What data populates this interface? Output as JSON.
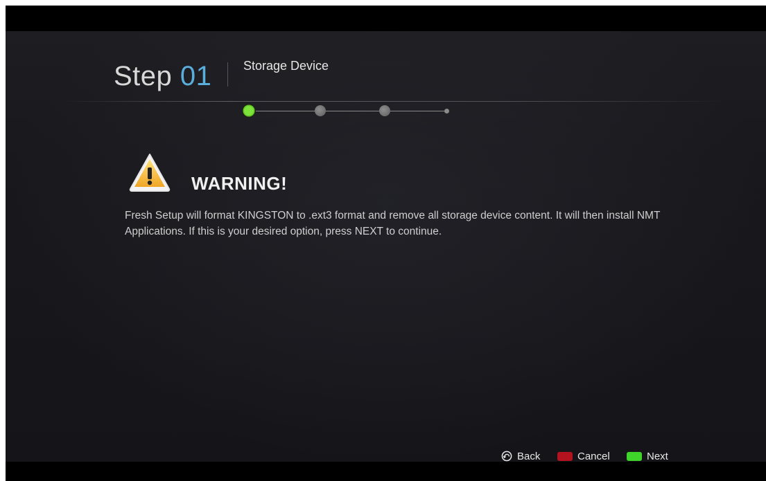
{
  "header": {
    "step_word": "Step",
    "step_number": "01",
    "step_title": "Storage Device",
    "progress": {
      "current_step": 1,
      "total_steps": 4
    }
  },
  "warning": {
    "icon": "warning-triangle-icon",
    "title": "WARNING!",
    "message": "Fresh Setup will format KINGSTON to .ext3 format and remove all storage device content. It will then install NMT Applications. If this is your desired option, press NEXT to continue."
  },
  "footer": {
    "back": {
      "label": "Back",
      "icon": "back-arrow-icon"
    },
    "cancel": {
      "label": "Cancel",
      "color": "#b3121f"
    },
    "next": {
      "label": "Next",
      "color": "#3fd42a"
    }
  },
  "colors": {
    "accent": "#5aaedb",
    "active_step": "#7ee23d",
    "background": "#19191d"
  }
}
